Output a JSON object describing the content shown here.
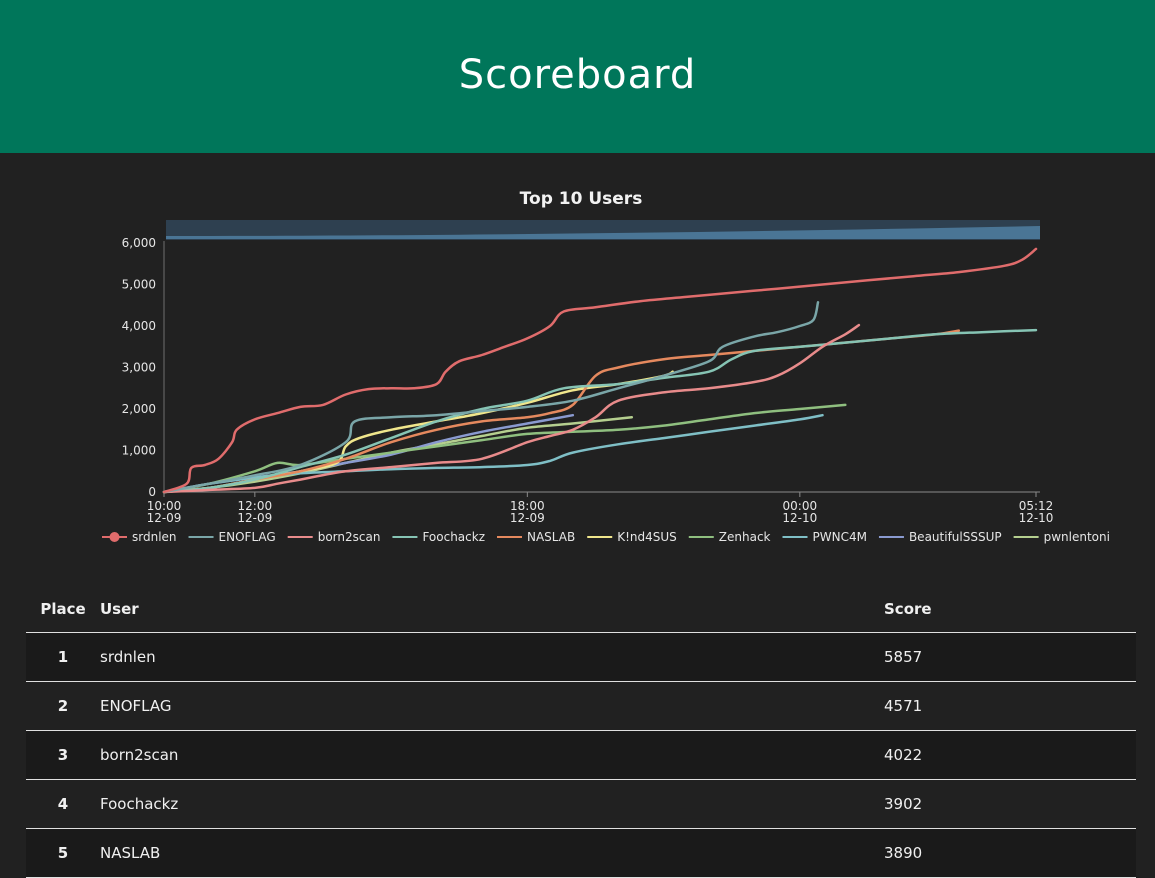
{
  "header": {
    "title": "Scoreboard"
  },
  "chart_data": {
    "type": "line",
    "title": "Top 10 Users",
    "x_ticks": [
      {
        "time": "10:00",
        "date": "12-09",
        "h": 0
      },
      {
        "time": "12:00",
        "date": "12-09",
        "h": 2
      },
      {
        "time": "18:00",
        "date": "12-09",
        "h": 8
      },
      {
        "time": "00:00",
        "date": "12-10",
        "h": 14
      },
      {
        "time": "05:12",
        "date": "12-10",
        "h": 19.2
      }
    ],
    "y_ticks": [
      0,
      1000,
      2000,
      3000,
      4000,
      5000,
      6000
    ],
    "xlim": [
      0,
      19.2
    ],
    "ylim": [
      0,
      6000
    ],
    "legend_position": "bottom",
    "series": [
      {
        "name": "srdnlen",
        "color": "#e06c6c",
        "marker": true,
        "points": [
          [
            0,
            0
          ],
          [
            0.5,
            200
          ],
          [
            0.6,
            580
          ],
          [
            0.9,
            650
          ],
          [
            1.2,
            800
          ],
          [
            1.5,
            1200
          ],
          [
            1.6,
            1500
          ],
          [
            2,
            1750
          ],
          [
            2.5,
            1900
          ],
          [
            3,
            2050
          ],
          [
            3.5,
            2100
          ],
          [
            4,
            2350
          ],
          [
            4.5,
            2480
          ],
          [
            5,
            2500
          ],
          [
            5.5,
            2500
          ],
          [
            6,
            2600
          ],
          [
            6.2,
            2900
          ],
          [
            6.5,
            3150
          ],
          [
            7,
            3300
          ],
          [
            7.5,
            3500
          ],
          [
            8,
            3700
          ],
          [
            8.5,
            4000
          ],
          [
            8.8,
            4350
          ],
          [
            9.5,
            4450
          ],
          [
            10.5,
            4600
          ],
          [
            11.5,
            4700
          ],
          [
            12.5,
            4800
          ],
          [
            13.5,
            4900
          ],
          [
            14.5,
            5000
          ],
          [
            15.5,
            5100
          ],
          [
            16.5,
            5200
          ],
          [
            17.5,
            5300
          ],
          [
            18.5,
            5450
          ],
          [
            18.9,
            5600
          ],
          [
            19.2,
            5857
          ]
        ]
      },
      {
        "name": "ENOFLAG",
        "color": "#7aa6a8",
        "marker": false,
        "points": [
          [
            0,
            0
          ],
          [
            1,
            200
          ],
          [
            2,
            400
          ],
          [
            3,
            650
          ],
          [
            4,
            1200
          ],
          [
            4.2,
            1700
          ],
          [
            5,
            1800
          ],
          [
            6,
            1850
          ],
          [
            7,
            1950
          ],
          [
            8,
            2050
          ],
          [
            9,
            2200
          ],
          [
            10,
            2500
          ],
          [
            11,
            2800
          ],
          [
            12,
            3150
          ],
          [
            12.3,
            3500
          ],
          [
            13,
            3750
          ],
          [
            13.5,
            3850
          ],
          [
            14,
            4000
          ],
          [
            14.3,
            4150
          ],
          [
            14.4,
            4571
          ]
        ]
      },
      {
        "name": "born2scan",
        "color": "#e88b8b",
        "marker": false,
        "points": [
          [
            0,
            0
          ],
          [
            1,
            50
          ],
          [
            2,
            100
          ],
          [
            2.5,
            200
          ],
          [
            3,
            300
          ],
          [
            4,
            500
          ],
          [
            5,
            600
          ],
          [
            6,
            700
          ],
          [
            7,
            800
          ],
          [
            8,
            1200
          ],
          [
            8.5,
            1350
          ],
          [
            9,
            1500
          ],
          [
            9.5,
            1800
          ],
          [
            10,
            2200
          ],
          [
            11,
            2400
          ],
          [
            12,
            2500
          ],
          [
            13,
            2650
          ],
          [
            13.5,
            2800
          ],
          [
            14,
            3100
          ],
          [
            14.5,
            3500
          ],
          [
            15,
            3800
          ],
          [
            15.3,
            4022
          ]
        ]
      },
      {
        "name": "Foochackz",
        "color": "#86c4b4",
        "marker": false,
        "points": [
          [
            0,
            0
          ],
          [
            1,
            100
          ],
          [
            2,
            300
          ],
          [
            3,
            600
          ],
          [
            4,
            900
          ],
          [
            5,
            1300
          ],
          [
            6,
            1700
          ],
          [
            7,
            2000
          ],
          [
            8,
            2200
          ],
          [
            8.8,
            2500
          ],
          [
            10,
            2600
          ],
          [
            11,
            2750
          ],
          [
            12,
            2900
          ],
          [
            12.5,
            3200
          ],
          [
            13,
            3400
          ],
          [
            14,
            3500
          ],
          [
            15,
            3600
          ],
          [
            16,
            3700
          ],
          [
            17,
            3800
          ],
          [
            18,
            3850
          ],
          [
            19.2,
            3902
          ]
        ]
      },
      {
        "name": "NASLAB",
        "color": "#e5895e",
        "marker": false,
        "points": [
          [
            0,
            0
          ],
          [
            1,
            100
          ],
          [
            2,
            300
          ],
          [
            3,
            500
          ],
          [
            4,
            800
          ],
          [
            5,
            1200
          ],
          [
            6,
            1500
          ],
          [
            7,
            1700
          ],
          [
            8,
            1800
          ],
          [
            8.5,
            1900
          ],
          [
            9,
            2100
          ],
          [
            9.5,
            2800
          ],
          [
            10,
            3000
          ],
          [
            11,
            3200
          ],
          [
            12,
            3300
          ],
          [
            13,
            3400
          ],
          [
            14,
            3500
          ],
          [
            15,
            3600
          ],
          [
            16,
            3700
          ],
          [
            17,
            3800
          ],
          [
            17.5,
            3890
          ]
        ]
      },
      {
        "name": "K!nd4SUS",
        "color": "#f0e68c",
        "marker": false,
        "points": [
          [
            0,
            0
          ],
          [
            1,
            100
          ],
          [
            2,
            300
          ],
          [
            3,
            500
          ],
          [
            3.8,
            700
          ],
          [
            4,
            1100
          ],
          [
            4.3,
            1300
          ],
          [
            5,
            1500
          ],
          [
            6,
            1700
          ],
          [
            7,
            1900
          ],
          [
            8,
            2150
          ],
          [
            9,
            2450
          ],
          [
            10,
            2600
          ],
          [
            11,
            2800
          ],
          [
            11.2,
            2900
          ]
        ]
      },
      {
        "name": "Zenhack",
        "color": "#8fbf7f",
        "marker": false,
        "points": [
          [
            0,
            0
          ],
          [
            1,
            200
          ],
          [
            2,
            500
          ],
          [
            2.5,
            700
          ],
          [
            3,
            650
          ],
          [
            4,
            800
          ],
          [
            5,
            950
          ],
          [
            6,
            1100
          ],
          [
            7,
            1250
          ],
          [
            8,
            1400
          ],
          [
            9,
            1450
          ],
          [
            10,
            1500
          ],
          [
            11,
            1600
          ],
          [
            12,
            1750
          ],
          [
            13,
            1900
          ],
          [
            14,
            2000
          ],
          [
            15,
            2100
          ]
        ]
      },
      {
        "name": "PWNC4M",
        "color": "#7fbfc6",
        "marker": false,
        "points": [
          [
            0,
            0
          ],
          [
            1,
            200
          ],
          [
            2,
            350
          ],
          [
            3,
            450
          ],
          [
            4,
            500
          ],
          [
            5,
            550
          ],
          [
            6,
            580
          ],
          [
            7,
            600
          ],
          [
            8,
            650
          ],
          [
            8.5,
            750
          ],
          [
            9,
            950
          ],
          [
            10,
            1150
          ],
          [
            11,
            1300
          ],
          [
            12,
            1450
          ],
          [
            13,
            1600
          ],
          [
            14,
            1750
          ],
          [
            14.5,
            1850
          ]
        ]
      },
      {
        "name": "BeautifulSSSUP",
        "color": "#8a9ad0",
        "marker": false,
        "points": [
          [
            0,
            0
          ],
          [
            1,
            200
          ],
          [
            2,
            350
          ],
          [
            3,
            500
          ],
          [
            4,
            700
          ],
          [
            5,
            900
          ],
          [
            6,
            1200
          ],
          [
            7,
            1450
          ],
          [
            8,
            1650
          ],
          [
            9,
            1850
          ]
        ]
      },
      {
        "name": "pwnlentoni",
        "color": "#b5cf8f",
        "marker": false,
        "points": [
          [
            0,
            0
          ],
          [
            1,
            100
          ],
          [
            2,
            250
          ],
          [
            3,
            450
          ],
          [
            4,
            700
          ],
          [
            5,
            950
          ],
          [
            6,
            1150
          ],
          [
            7,
            1350
          ],
          [
            8,
            1550
          ],
          [
            9,
            1650
          ],
          [
            10.3,
            1800
          ]
        ]
      }
    ]
  },
  "table": {
    "columns": {
      "place": "Place",
      "user": "User",
      "score": "Score"
    },
    "rows": [
      {
        "place": "1",
        "user": "srdnlen",
        "score": "5857"
      },
      {
        "place": "2",
        "user": "ENOFLAG",
        "score": "4571"
      },
      {
        "place": "3",
        "user": "born2scan",
        "score": "4022"
      },
      {
        "place": "4",
        "user": "Foochackz",
        "score": "3902"
      },
      {
        "place": "5",
        "user": "NASLAB",
        "score": "3890"
      }
    ]
  }
}
